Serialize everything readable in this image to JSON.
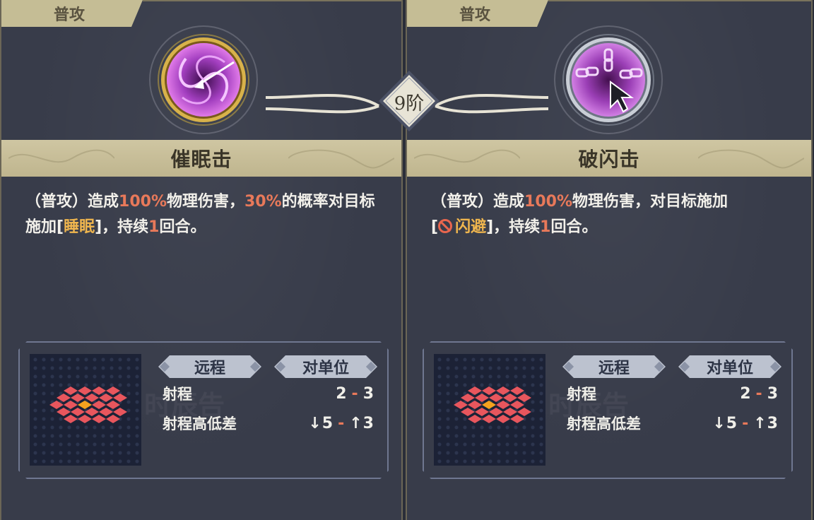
{
  "tier_label": "9阶",
  "cards": [
    {
      "type_label": "普攻",
      "skill_name": "催眠击",
      "desc": {
        "p1": "（普攻）造成",
        "v1": "100%",
        "p2": "物理伤害，",
        "v2": "30%",
        "p3": "的概率对目标施加[",
        "status": "睡眠",
        "p4": "]，持续",
        "v3": "1",
        "p5": "回合。"
      },
      "tags": [
        "远程",
        "对单位"
      ],
      "stats": [
        {
          "label": "射程",
          "min": "2",
          "sep": "-",
          "max": "3"
        },
        {
          "label": "射程高低差",
          "min": "↓5",
          "sep": "-",
          "max": "↑3"
        }
      ],
      "icon": "hypnosis-spiral-icon",
      "orb_color": "#b24fc9"
    },
    {
      "type_label": "普攻",
      "skill_name": "破闪击",
      "desc": {
        "p1": "（普攻）造成",
        "v1": "100%",
        "p2": "物理伤害，对目标施加",
        "p3": "[",
        "status": "闪避",
        "p4": "]，持续",
        "v3": "1",
        "p5": "回合。"
      },
      "tags": [
        "远程",
        "对单位"
      ],
      "stats": [
        {
          "label": "射程",
          "min": "2",
          "sep": "-",
          "max": "3"
        },
        {
          "label": "射程高低差",
          "min": "↓5",
          "sep": "-",
          "max": "↑3"
        }
      ],
      "icon": "chain-strike-icon",
      "orb_color": "#a64ec4"
    }
  ],
  "colors": {
    "highlight_red": "#e8795a",
    "highlight_gold": "#f0b64e",
    "band": "#c5bd95",
    "panel": "#383c4a"
  }
}
